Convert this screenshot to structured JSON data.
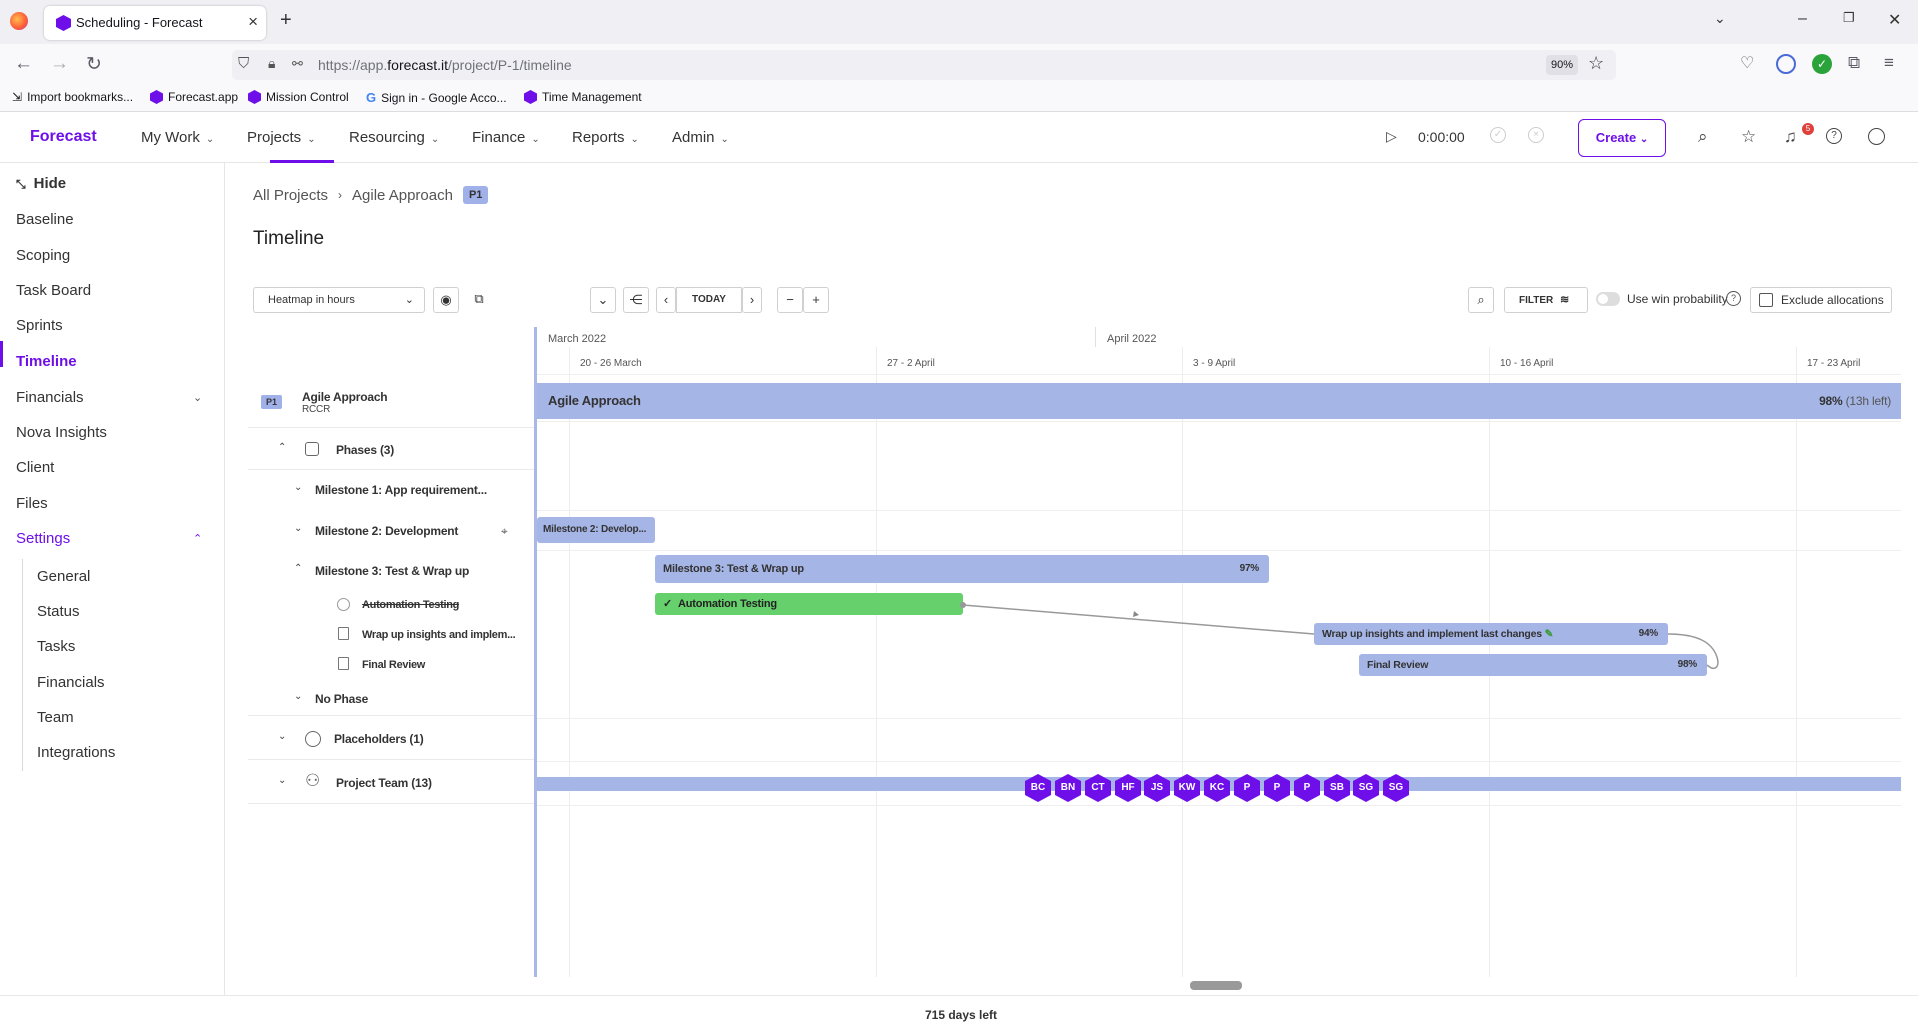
{
  "browser": {
    "tab_title": "Scheduling - Forecast",
    "url_prefix": "https://app.",
    "url_domain": "forecast.it",
    "url_path": "/project/P-1/timeline",
    "zoom": "90%",
    "bookmarks": [
      "Import bookmarks...",
      "Forecast.app",
      "Mission Control",
      "Sign in - Google Acco...",
      "Time Management"
    ]
  },
  "app": {
    "brand": "Forecast",
    "menu": [
      "My Work",
      "Projects",
      "Resourcing",
      "Finance",
      "Reports",
      "Admin"
    ],
    "active_menu": "Projects",
    "timer": "0:00:00",
    "create_label": "Create",
    "notification_count": "5"
  },
  "sidebar": {
    "hide_label": "Hide",
    "items": [
      "Baseline",
      "Scoping",
      "Task Board",
      "Sprints",
      "Timeline",
      "Financials",
      "Nova Insights",
      "Client",
      "Files",
      "Settings"
    ],
    "active": "Timeline",
    "settings_sub": [
      "General",
      "Status",
      "Tasks",
      "Financials",
      "Team",
      "Integrations"
    ]
  },
  "header": {
    "crumb_all": "All Projects",
    "crumb_project": "Agile Approach",
    "project_badge": "P1",
    "page_title": "Timeline"
  },
  "toolbar": {
    "heatmap_select": "Heatmap in hours",
    "today_label": "TODAY",
    "filter_label": "FILTER",
    "win_prob_label": "Use win probability",
    "exclude_label": "Exclude allocations"
  },
  "tree": {
    "project_badge": "P1",
    "project_name": "Agile Approach",
    "project_code": "RCCR",
    "phases_label": "Phases (3)",
    "milestone1": "Milestone 1: App requirement...",
    "milestone2": "Milestone 2: Development",
    "milestone3": "Milestone 3: Test & Wrap up",
    "task1": "Automation Testing",
    "task2": "Wrap up insights and implem...",
    "task3": "Final Review",
    "no_phase": "No Phase",
    "placeholders": "Placeholders (1)",
    "project_team": "Project Team (13)"
  },
  "timeline": {
    "months": [
      "March 2022",
      "April 2022"
    ],
    "weeks": [
      "20 - 26 March",
      "27 - 2 April",
      "3 - 9 April",
      "10 - 16 April",
      "17 - 23 April"
    ],
    "project_bar": {
      "label": "Agile Approach",
      "pct": "98%",
      "left": "(13h left)"
    },
    "milestone2_bar": "Milestone 2: Develop...",
    "milestone3_bar": {
      "label": "Milestone 3: Test & Wrap up",
      "pct": "97%"
    },
    "task1_bar": "Automation Testing",
    "task2_bar": {
      "label": "Wrap up insights and implement last changes",
      "pct": "94%"
    },
    "task3_bar": {
      "label": "Final Review",
      "pct": "98%"
    },
    "team_initials": [
      "BC",
      "BN",
      "CT",
      "HF",
      "JS",
      "KW",
      "KC",
      "P",
      "P",
      "P",
      "SB",
      "SG",
      "SG"
    ]
  },
  "footer": {
    "days_left": "715 days left"
  },
  "colors": {
    "accent": "#6e0fea",
    "bar_blue": "#a5b5e6",
    "bar_green": "#65d06c"
  }
}
